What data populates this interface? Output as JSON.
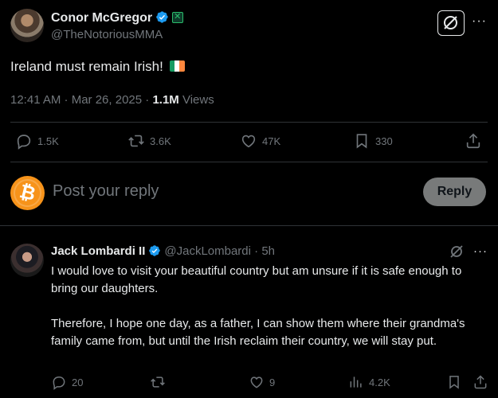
{
  "tweet": {
    "author_name": "Conor McGregor",
    "handle": "@TheNotoriousMMA",
    "text": "Ireland must remain Irish!",
    "flag_colors": [
      "#169b62",
      "#ffffff",
      "#ff883e"
    ],
    "time": "12:41 AM · Mar 26, 2025 · ",
    "views_count": "1.1M",
    "views_label": " Views",
    "more_label": "···",
    "stats": {
      "replies": "1.5K",
      "reposts": "3.6K",
      "likes": "47K",
      "bookmarks": "330"
    }
  },
  "composer": {
    "placeholder": "Post your reply",
    "reply_button": "Reply"
  },
  "reply": {
    "author_name": "Jack Lombardi II",
    "handle": "@JackLombardi",
    "time": " · 5h",
    "paragraph_1": "I would love to visit your beautiful country but am unsure if it is safe enough to bring our daughters.",
    "paragraph_2": "Therefore, I hope one day, as a father, I can show them where their grandma's family came from, but until the Irish reclaim their country, we will stay put.",
    "more_label": "···",
    "stats": {
      "replies": "20",
      "likes": "9",
      "views": "4.2K"
    }
  },
  "colors": {
    "background": "#000000",
    "text": "#e7e9ea",
    "muted": "#71767b",
    "verified": "#1d9bf0",
    "divider": "#2f3336",
    "bitcoin": "#f7931a"
  }
}
